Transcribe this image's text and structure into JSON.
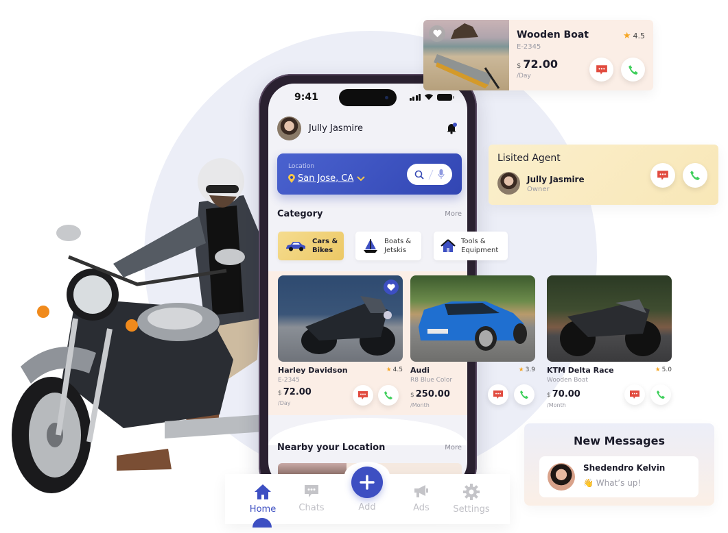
{
  "phone": {
    "status_time": "9:41",
    "user_name": "Jully Jasmire",
    "location": {
      "label": "Location",
      "value": "San Jose, CA"
    },
    "category": {
      "title": "Category",
      "more": "More",
      "items": [
        {
          "label_line1": "Cars &",
          "label_line2": "Bikes",
          "icon": "car-icon",
          "active": true
        },
        {
          "label_line1": "Boats &",
          "label_line2": "Jetskis",
          "icon": "sailboat-icon",
          "active": false
        },
        {
          "label_line1": "Tools &",
          "label_line2": "Equipment",
          "icon": "house-icon",
          "active": false
        }
      ]
    },
    "listings": [
      {
        "name": "Harley Davidson",
        "subtitle": "E-2345",
        "rating": "4.5",
        "currency": "$",
        "price": "72.00",
        "period": "/Day",
        "favorited": true
      },
      {
        "name": "Audi",
        "subtitle": "R8 Blue Color",
        "rating": "3.9",
        "currency": "$",
        "price": "250.00",
        "period": "/Month",
        "favorited": false
      },
      {
        "name": "KTM Delta Race",
        "subtitle": "Wooden Boat",
        "rating": "5.0",
        "currency": "$",
        "price": "70.00",
        "period": "/Month",
        "favorited": false
      }
    ],
    "nearby": {
      "title": "Nearby your Location",
      "more": "More"
    },
    "bottom_nav": {
      "items": [
        {
          "label": "Home",
          "icon": "home-icon",
          "active": true
        },
        {
          "label": "Chats",
          "icon": "chat-icon",
          "active": false
        },
        {
          "label": "Add",
          "icon": "plus-icon",
          "active": false
        },
        {
          "label": "Ads",
          "icon": "megaphone-icon",
          "active": false
        },
        {
          "label": "Settings",
          "icon": "gear-icon",
          "active": false
        }
      ]
    }
  },
  "featured_card": {
    "title": "Wooden Boat",
    "subtitle": "E-2345",
    "rating": "4.5",
    "currency": "$",
    "price": "72.00",
    "period": "/Day"
  },
  "agent_card": {
    "title": "Lisited Agent",
    "name": "Jully Jasmire",
    "role": "Owner"
  },
  "messages_card": {
    "title": "New Messages",
    "sender": "Shedendro Kelvin",
    "emoji": "👋",
    "text": "What’s up!"
  },
  "colors": {
    "primary": "#3d4fc2",
    "accent_yellow": "#ecc865",
    "chat_red": "#e14b3f",
    "call_green": "#3fcf5c",
    "star": "#f6a623"
  }
}
